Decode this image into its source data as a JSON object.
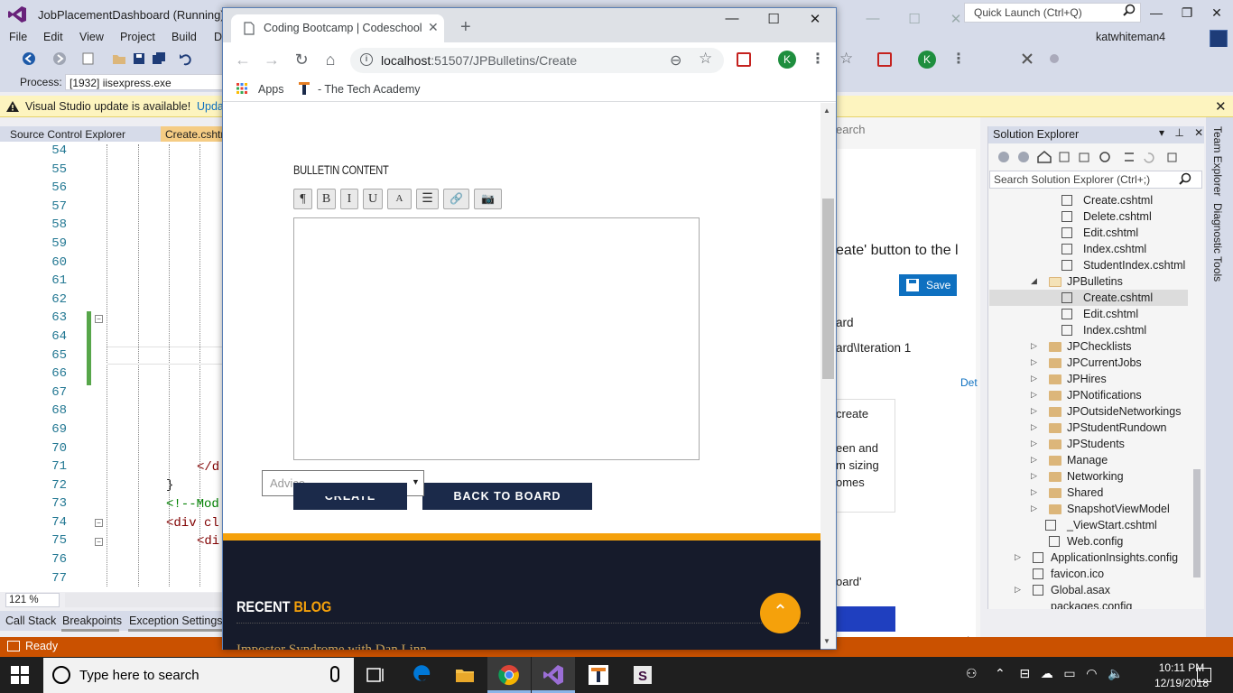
{
  "vs": {
    "title": "JobPlacementDashboard (Running) - M",
    "quick_launch": "Quick Launch (Ctrl+Q)",
    "menu": [
      "File",
      "Edit",
      "View",
      "Project",
      "Build",
      "D"
    ],
    "user": "katwhiteman4",
    "process_label": "Process:",
    "process_value": "[1932] iisexpress.exe",
    "info_text": "Visual Studio update is available!",
    "info_link": "Upda",
    "tabs": {
      "source_control": "Source Control Explorer",
      "create": "Create.cshtml"
    },
    "line_numbers": [
      "54",
      "55",
      "56",
      "57",
      "58",
      "59",
      "60",
      "61",
      "62",
      "63",
      "64",
      "65",
      "66",
      "67",
      "68",
      "69",
      "70",
      "71",
      "72",
      "73",
      "74",
      "75",
      "76",
      "77"
    ],
    "code": {
      "l71": "</d",
      "l72": "}",
      "l73": "<!--Mod",
      "l74": "<div cl",
      "l75": "<di"
    },
    "zoom": "121 %",
    "bottom_tabs": [
      "Call Stack",
      "Breakpoints",
      "Exception Settings"
    ],
    "status": "Ready",
    "middle_panel": {
      "search": "earch",
      "save": "Save",
      "lines": [
        "eate' button to the l",
        "ard",
        "ard\\Iteration 1",
        "Det",
        "create",
        "een and",
        "m sizing",
        "omes",
        "oard'"
      ]
    },
    "solution_explorer": {
      "title": "Solution Explorer",
      "search_placeholder": "Search Solution Explorer (Ctrl+;)",
      "items": [
        {
          "label": "Create.cshtml"
        },
        {
          "label": "Delete.cshtml"
        },
        {
          "label": "Edit.cshtml"
        },
        {
          "label": "Index.cshtml"
        },
        {
          "label": "StudentIndex.cshtml"
        },
        {
          "label": "JPBulletins"
        },
        {
          "label": "Create.cshtml"
        },
        {
          "label": "Edit.cshtml"
        },
        {
          "label": "Index.cshtml"
        },
        {
          "label": "JPChecklists"
        },
        {
          "label": "JPCurrentJobs"
        },
        {
          "label": "JPHires"
        },
        {
          "label": "JPNotifications"
        },
        {
          "label": "JPOutsideNetworkings"
        },
        {
          "label": "JPStudentRundown"
        },
        {
          "label": "JPStudents"
        },
        {
          "label": "Manage"
        },
        {
          "label": "Networking"
        },
        {
          "label": "Shared"
        },
        {
          "label": "SnapshotViewModel"
        },
        {
          "label": "_ViewStart.cshtml"
        },
        {
          "label": "Web.config"
        },
        {
          "label": "ApplicationInsights.config"
        },
        {
          "label": "favicon.ico"
        },
        {
          "label": "Global.asax"
        },
        {
          "label": "packages.config"
        }
      ]
    },
    "side_tabs": [
      "Team Explorer",
      "Diagnostic Tools"
    ]
  },
  "chrome": {
    "tab_title": "Coding Bootcamp | Codeschool |",
    "url_host": "localhost",
    "url_path": ":51507/JPBulletins/Create",
    "profile_initial": "K",
    "bookmarks": [
      "Apps",
      "- The Tech Academy"
    ]
  },
  "page": {
    "bulletin_label": "BULLETIN CONTENT",
    "editor_buttons": [
      "¶",
      "B",
      "I",
      "U",
      "A",
      "☰",
      "🔗",
      "📷"
    ],
    "category_placeholder": "Advice",
    "create_button": "CREATE",
    "back_button": "BACK TO BOARD",
    "footer_heading_1": "RECENT",
    "footer_heading_2": "BLOG",
    "blog_teaser": "Impostor Syndrome with Dan Linn"
  },
  "taskbar": {
    "search_text": "Type here to search",
    "time": "10:11 PM",
    "date": "12/19/2018"
  }
}
